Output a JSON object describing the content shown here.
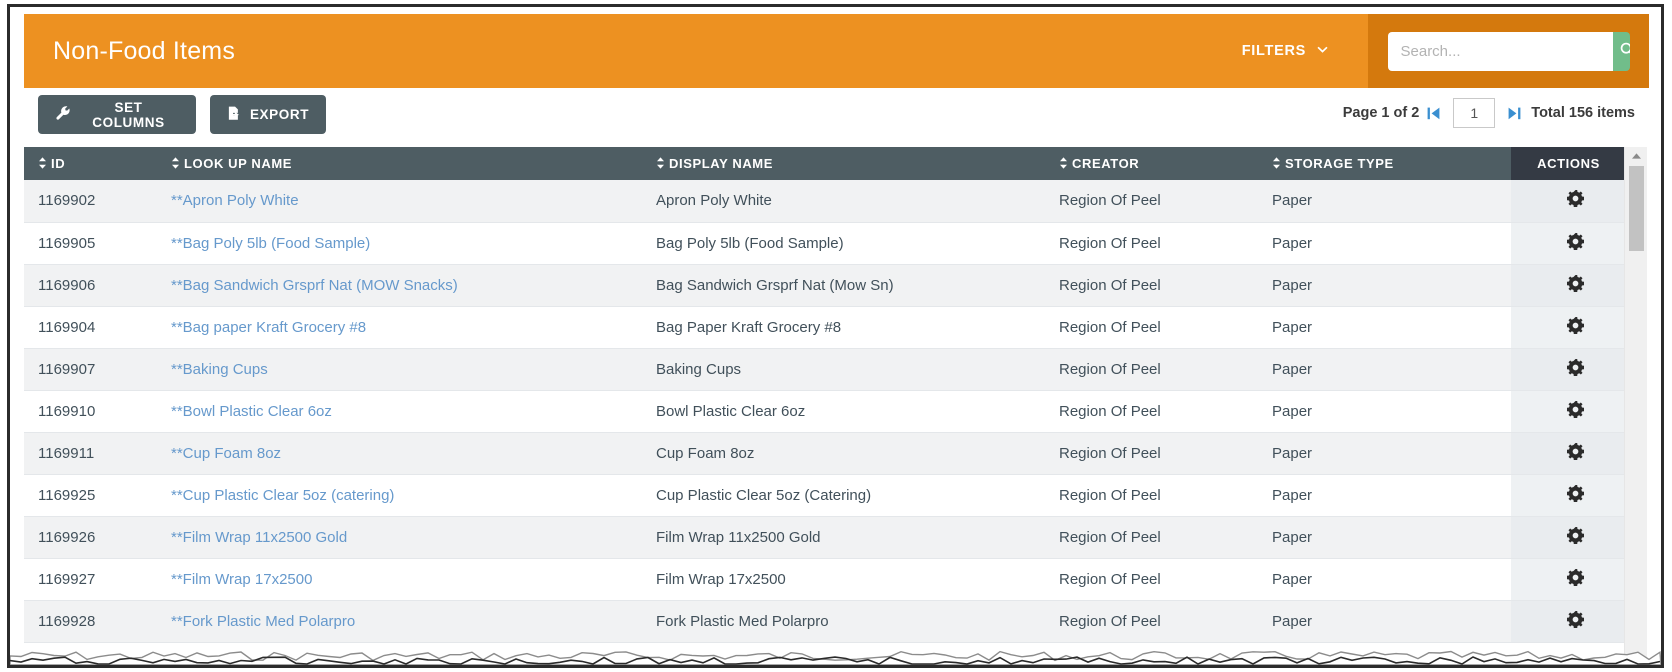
{
  "header": {
    "title": "Non-Food Items",
    "filters_label": "FILTERS",
    "filters_icon": "chevron-down-icon",
    "accent_orange": "#ed9121",
    "accent_orange_dark": "#d4790d",
    "search_button_green": "#71bd8a"
  },
  "search": {
    "placeholder": "Search...",
    "value": "",
    "icon": "search-icon"
  },
  "toolbar": {
    "set_columns_label": "SET COLUMNS",
    "set_columns_icon": "wrench-icon",
    "export_label": "EXPORT",
    "export_icon": "file-export-icon"
  },
  "pagination": {
    "page_label": "Page 1 of 2",
    "first_page_icon": "first-page-icon",
    "last_page_icon": "last-page-icon",
    "page_value": "1",
    "total_label": "Total 156 items"
  },
  "table": {
    "columns": [
      {
        "label": "ID",
        "sortable": true
      },
      {
        "label": "LOOK UP NAME",
        "sortable": true
      },
      {
        "label": "DISPLAY NAME",
        "sortable": true
      },
      {
        "label": "CREATOR",
        "sortable": true
      },
      {
        "label": "STORAGE TYPE",
        "sortable": true
      },
      {
        "label": "ACTIONS",
        "sortable": false
      }
    ],
    "row_action_icon": "gear-icon",
    "rows": [
      {
        "id": "1169902",
        "lookup": "**Apron Poly White",
        "display": "Apron Poly White",
        "creator": "Region Of Peel",
        "storage": "Paper"
      },
      {
        "id": "1169905",
        "lookup": "**Bag Poly 5lb (Food Sample)",
        "display": "Bag Poly 5lb (Food Sample)",
        "creator": "Region Of Peel",
        "storage": "Paper"
      },
      {
        "id": "1169906",
        "lookup": "**Bag Sandwich Grsprf Nat (MOW Snacks)",
        "display": "Bag Sandwich Grsprf Nat (Mow Sn)",
        "creator": "Region Of Peel",
        "storage": "Paper"
      },
      {
        "id": "1169904",
        "lookup": "**Bag paper Kraft Grocery #8",
        "display": "Bag Paper Kraft Grocery #8",
        "creator": "Region Of Peel",
        "storage": "Paper"
      },
      {
        "id": "1169907",
        "lookup": "**Baking Cups",
        "display": "Baking Cups",
        "creator": "Region Of Peel",
        "storage": "Paper"
      },
      {
        "id": "1169910",
        "lookup": "**Bowl Plastic Clear 6oz",
        "display": "Bowl Plastic Clear 6oz",
        "creator": "Region Of Peel",
        "storage": "Paper"
      },
      {
        "id": "1169911",
        "lookup": "**Cup Foam 8oz",
        "display": "Cup Foam 8oz",
        "creator": "Region Of Peel",
        "storage": "Paper"
      },
      {
        "id": "1169925",
        "lookup": "**Cup Plastic Clear 5oz (catering)",
        "display": "Cup Plastic Clear 5oz (Catering)",
        "creator": "Region Of Peel",
        "storage": "Paper"
      },
      {
        "id": "1169926",
        "lookup": "**Film Wrap 11x2500 Gold",
        "display": "Film Wrap 11x2500 Gold",
        "creator": "Region Of Peel",
        "storage": "Paper"
      },
      {
        "id": "1169927",
        "lookup": "**Film Wrap 17x2500",
        "display": "Film Wrap 17x2500",
        "creator": "Region Of Peel",
        "storage": "Paper"
      },
      {
        "id": "1169928",
        "lookup": "**Fork Plastic Med Polarpro",
        "display": "Fork Plastic Med Polarpro",
        "creator": "Region Of Peel",
        "storage": "Paper"
      }
    ]
  },
  "scrollbar": {
    "up_arrow_icon": "caret-up-icon"
  }
}
